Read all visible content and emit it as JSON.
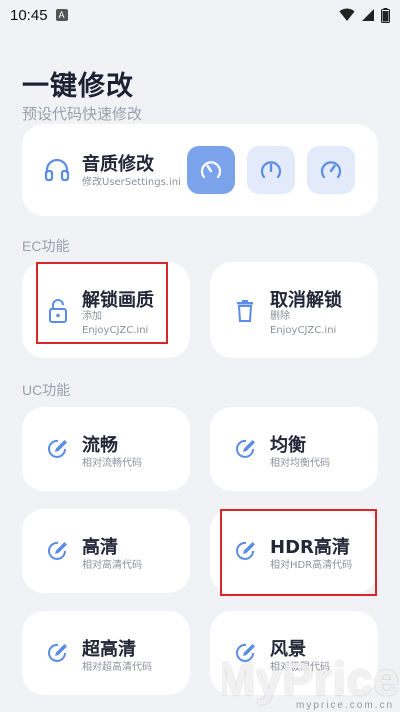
{
  "status_bar": {
    "time": "10:45",
    "badge": "A"
  },
  "page": {
    "title": "一键修改",
    "subtitle": "预设代码快速修改"
  },
  "quality_card": {
    "title": "音质修改",
    "desc": "修改UserSettings.ini",
    "icon": "headphones-icon",
    "options": [
      {
        "icon": "gauge-icon",
        "selected": true
      },
      {
        "icon": "gauge-icon",
        "selected": false
      },
      {
        "icon": "gauge-icon",
        "selected": false
      }
    ]
  },
  "ec_section": {
    "label": "EC功能",
    "cards": [
      {
        "title": "解锁画质",
        "desc_line1": "添加",
        "desc_line2": "EnjoyCJZC.ini",
        "icon": "lock-open-icon"
      },
      {
        "title": "取消解锁",
        "desc_line1": "删除",
        "desc_line2": "EnjoyCJZC.ini",
        "icon": "trash-icon"
      }
    ]
  },
  "uc_section": {
    "label": "UC功能",
    "cards": [
      {
        "title": "流畅",
        "desc": "相对流畅代码",
        "icon": "edit-icon"
      },
      {
        "title": "均衡",
        "desc": "相对均衡代码",
        "icon": "edit-icon"
      },
      {
        "title": "高清",
        "desc": "相对高清代码",
        "icon": "edit-icon"
      },
      {
        "title": "HDR高清",
        "desc": "相对HDR高清代码",
        "icon": "edit-icon"
      },
      {
        "title": "超高清",
        "desc": "相对超高清代码",
        "icon": "edit-icon"
      },
      {
        "title": "风景",
        "desc": "相对极限代码",
        "icon": "edit-icon"
      }
    ]
  },
  "watermark": {
    "main": "MyPrice",
    "sub": "myprice.com.cn"
  },
  "colors": {
    "accent": "#5b8ce6",
    "accent_light": "#e3ebfb",
    "selected_bg": "#7aa3ec",
    "highlight": "#d9262b"
  }
}
